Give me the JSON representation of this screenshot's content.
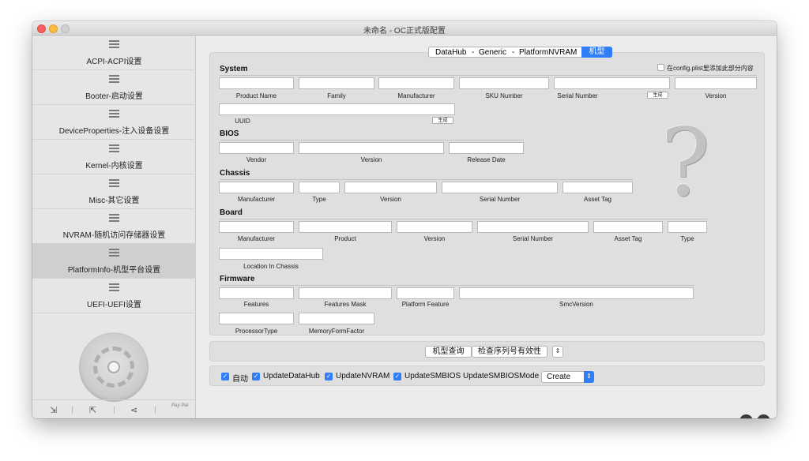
{
  "window": {
    "title": "未命名 - OC正式版配置"
  },
  "sidebar": {
    "items": [
      {
        "label": "ACPI-ACPI设置"
      },
      {
        "label": "Booter-启动设置"
      },
      {
        "label": "DeviceProperties-注入设备设置"
      },
      {
        "label": "Kernel-内核设置"
      },
      {
        "label": "Misc-其它设置"
      },
      {
        "label": "NVRAM-随机访问存储器设置"
      },
      {
        "label": "PlatformInfo-机型平台设置",
        "active": true
      },
      {
        "label": "UEFI-UEFI设置"
      }
    ],
    "bottom_icons": [
      "import-icon",
      "export-icon",
      "share-icon",
      "paypal-icon"
    ],
    "paypal_text": "Pay Pal"
  },
  "tabs": {
    "items": [
      "DataHub",
      "Generic",
      "PlatformNVRAM"
    ],
    "selected": "机型",
    "separator": "-"
  },
  "checkbox_add": {
    "label": "在config.plist里添加此部分内容",
    "checked": false
  },
  "generate_label": "生成",
  "sections": {
    "system": {
      "title": "System",
      "labels": [
        "Product Name",
        "Family",
        "Manufacturer",
        "SKU Number",
        "Serial Number",
        "Version",
        "UUID"
      ]
    },
    "bios": {
      "title": "BIOS",
      "labels": [
        "Vendor",
        "Version",
        "Release Date"
      ]
    },
    "chassis": {
      "title": "Chassis",
      "labels": [
        "Manufacturer",
        "Type",
        "Version",
        "Serial Number",
        "Asset Tag"
      ]
    },
    "board": {
      "title": "Board",
      "labels": [
        "Manufacturer",
        "Product",
        "Version",
        "Serial Number",
        "Asset Tag",
        "Type",
        "Location In Chassis"
      ]
    },
    "firmware": {
      "title": "Firmware",
      "labels": [
        "Features",
        "Features Mask",
        "Platform Feature",
        "SmcVersion",
        "ProcessorType",
        "MemoryFormFactor"
      ]
    }
  },
  "placeholder_glyph": "?",
  "actions": {
    "query": "机型查询",
    "check_serial": "检查序列号有效性",
    "stepper": "⇕"
  },
  "options": {
    "checkboxes": [
      {
        "label": "自动",
        "checked": true
      },
      {
        "label": "UpdateDataHub",
        "checked": true
      },
      {
        "label": "UpdateNVRAM",
        "checked": true
      },
      {
        "label": "UpdateSMBIOS",
        "checked": true
      }
    ],
    "mode_label": "UpdateSMBIOSMode",
    "mode_value": "Create"
  }
}
